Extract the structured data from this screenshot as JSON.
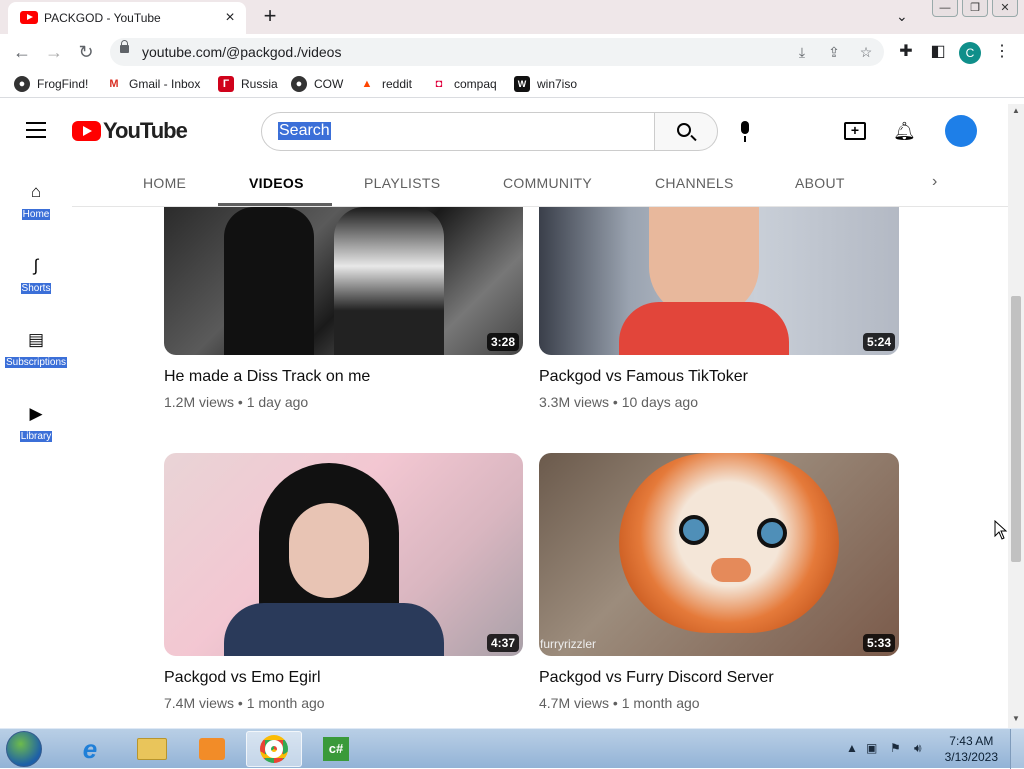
{
  "browser": {
    "tab_title": "PACKGOD - YouTube",
    "url": "youtube.com/@packgod./videos",
    "profile_initial": "C",
    "bookmarks": [
      {
        "label": "FrogFind!",
        "icon": "globe-icon"
      },
      {
        "label": "Gmail - Inbox",
        "icon": "gmail-icon"
      },
      {
        "label": "Russia",
        "icon": "russia-icon"
      },
      {
        "label": "COW",
        "icon": "globe-icon"
      },
      {
        "label": "reddit",
        "icon": "reddit-icon"
      },
      {
        "label": "compaq",
        "icon": "compaq-icon"
      },
      {
        "label": "win7iso",
        "icon": "win7iso-icon"
      }
    ],
    "window_controls": {
      "minimize": "—",
      "restore": "❐",
      "close": "✕"
    }
  },
  "youtube": {
    "logo_text": "YouTube",
    "search_placeholder": "Search",
    "nav": [
      {
        "label": "Home",
        "icon": "home-icon"
      },
      {
        "label": "Shorts",
        "icon": "shorts-icon"
      },
      {
        "label": "Subscriptions",
        "icon": "subscriptions-icon"
      },
      {
        "label": "Library",
        "icon": "library-icon"
      }
    ],
    "channel_tabs": [
      {
        "label": "HOME",
        "active": false
      },
      {
        "label": "VIDEOS",
        "active": true
      },
      {
        "label": "PLAYLISTS",
        "active": false
      },
      {
        "label": "COMMUNITY",
        "active": false
      },
      {
        "label": "CHANNELS",
        "active": false
      },
      {
        "label": "ABOUT",
        "active": false
      }
    ],
    "videos": [
      {
        "title": "He made a Diss Track on me",
        "views": "1.2M views",
        "age": "1 day ago",
        "duration": "3:28"
      },
      {
        "title": "Packgod vs Famous TikToker",
        "views": "3.3M views",
        "age": "10 days ago",
        "duration": "5:24"
      },
      {
        "title": "Packgod vs Emo Egirl",
        "views": "7.4M views",
        "age": "1 month ago",
        "duration": "4:37"
      },
      {
        "title": "Packgod vs Furry Discord Server",
        "views": "4.7M views",
        "age": "1 month ago",
        "duration": "5:33",
        "watermark": "furryrizzler"
      }
    ]
  },
  "taskbar": {
    "time": "7:43 AM",
    "date": "3/13/2023",
    "apps": [
      "internet-explorer-icon",
      "file-explorer-icon",
      "media-player-icon",
      "chrome-icon",
      "csharp-icon"
    ]
  },
  "colors": {
    "accent": "#ff0000",
    "selection": "#3b6fd8",
    "avatar": "#1e7fe8"
  }
}
